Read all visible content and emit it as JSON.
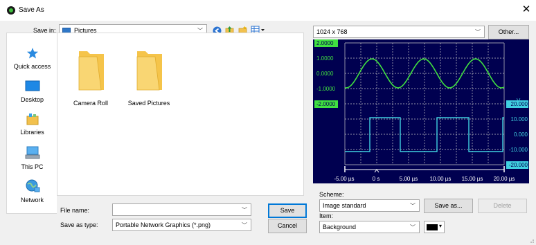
{
  "window": {
    "title": "Save As",
    "close_glyph": "✕"
  },
  "toolbar": {
    "save_in_label": "Save in:",
    "save_in_value": "Pictures",
    "icons": [
      "back-icon",
      "up-folder-icon",
      "new-folder-icon",
      "view-menu-icon"
    ]
  },
  "places": [
    {
      "label": "Quick access",
      "icon": "star-icon"
    },
    {
      "label": "Desktop",
      "icon": "desktop-icon"
    },
    {
      "label": "Libraries",
      "icon": "libraries-icon"
    },
    {
      "label": "This PC",
      "icon": "computer-icon"
    },
    {
      "label": "Network",
      "icon": "network-icon"
    }
  ],
  "files": [
    {
      "name": "Camera Roll",
      "icon": "folder-icon"
    },
    {
      "name": "Saved Pictures",
      "icon": "folder-icon"
    }
  ],
  "form": {
    "file_name_label": "File name:",
    "file_name_value": "",
    "save_as_type_label": "Save as type:",
    "save_as_type_value": "Portable Network Graphics (*.png)"
  },
  "buttons": {
    "save": "Save",
    "cancel": "Cancel"
  },
  "preview": {
    "resolution": "1024 x  768",
    "other_button": "Other...",
    "scope": {
      "left_labels": [
        "2.0000",
        "1.0000",
        "0.0000",
        "-1.0000",
        "-2.0000"
      ],
      "right_unit": "V",
      "right_labels": [
        "20.000",
        "10.000",
        "0.000",
        "-10.000",
        "-20.000"
      ],
      "x_labels": [
        "-5.00 µs",
        "0 s",
        "5.00 µs",
        "10.00 µs",
        "15.00 µs",
        "20.00 µs"
      ],
      "colors": {
        "background": "#000050",
        "sine": "#40e040",
        "square": "#40d0e0",
        "grid": "#c8c8c8"
      }
    },
    "scheme_label": "Scheme:",
    "scheme_value": "Image standard",
    "save_as_button": "Save as...",
    "delete_button": "Delete",
    "item_label": "Item:",
    "item_value": "Background",
    "item_color": "#000000"
  }
}
